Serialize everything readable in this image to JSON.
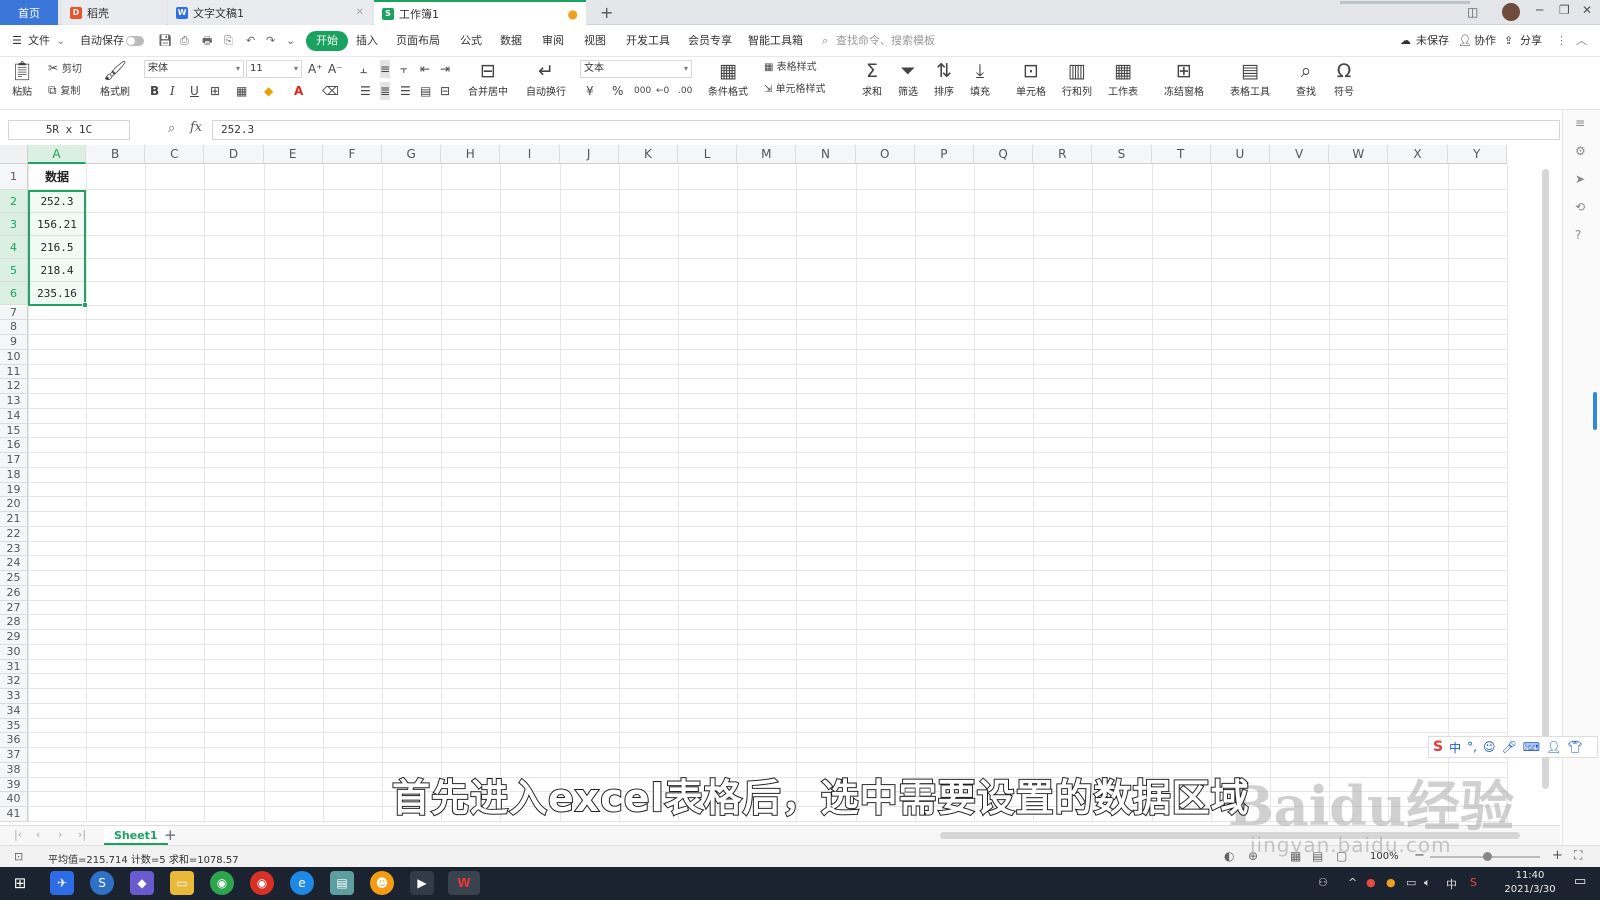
{
  "tabs": [
    {
      "label": "首页",
      "active": false
    },
    {
      "label": "稻壳",
      "icon": "D"
    },
    {
      "label": "文字文稿1",
      "icon": "W"
    },
    {
      "label": "工作簿1",
      "icon": "S",
      "active": true
    }
  ],
  "new_tab": "+",
  "window": {
    "min": "─",
    "restore": "❐",
    "close": "✕"
  },
  "menu": {
    "file": "文件",
    "autosave": "自动保存",
    "items": [
      "开始",
      "插入",
      "页面布局",
      "公式",
      "数据",
      "审阅",
      "视图",
      "开发工具",
      "会员专享",
      "智能工具箱"
    ],
    "search_placeholder": "查找命令、搜索模板",
    "unsaved": "未保存",
    "collab": "协作",
    "share": "分享"
  },
  "ribbon": {
    "paste": "粘贴",
    "cut": "剪切",
    "copy": "复制",
    "format_painter": "格式刷",
    "font_name": "宋体",
    "font_size": "11",
    "merge": "合并居中",
    "wrap": "自动换行",
    "number_format": "文本",
    "cond_format": "条件格式",
    "table_style": "表格样式",
    "cell_style": "单元格样式",
    "sum": "求和",
    "filter": "筛选",
    "sort": "排序",
    "fill": "填充",
    "cell": "单元格",
    "row_col": "行和列",
    "sheet": "工作表",
    "freeze": "冻结窗格",
    "table_tools": "表格工具",
    "find": "查找",
    "symbol": "符号"
  },
  "formula_bar": {
    "name_box": "5R x 1C",
    "fx": "fx",
    "value": "252.3"
  },
  "columns": [
    "A",
    "B",
    "C",
    "D",
    "E",
    "F",
    "G",
    "H",
    "I",
    "J",
    "K",
    "L",
    "M",
    "N",
    "O",
    "P",
    "Q",
    "R",
    "S",
    "T",
    "U",
    "V",
    "W",
    "X",
    "Y"
  ],
  "rows_count": 41,
  "cells": {
    "A1": "数据",
    "A2": "252.3",
    "A3": "156.21",
    "A4": "216.5",
    "A5": "218.4",
    "A6": "235.16"
  },
  "sheet_tab": "Sheet1",
  "status": {
    "text": "平均值=215.714  计数=5  求和=1078.57",
    "zoom": "100%"
  },
  "caption": "首先进入excel表格后，选中需要设置的数据区域",
  "watermark": {
    "brand": "Baidu经验",
    "url": "jingyan.baidu.com"
  },
  "ime": {
    "label": "中"
  },
  "clock": {
    "time": "11:40",
    "date": "2021/3/30"
  },
  "colors": {
    "accent": "#1aa260",
    "selection": "#21a366",
    "taskbar": "#1b2330"
  }
}
